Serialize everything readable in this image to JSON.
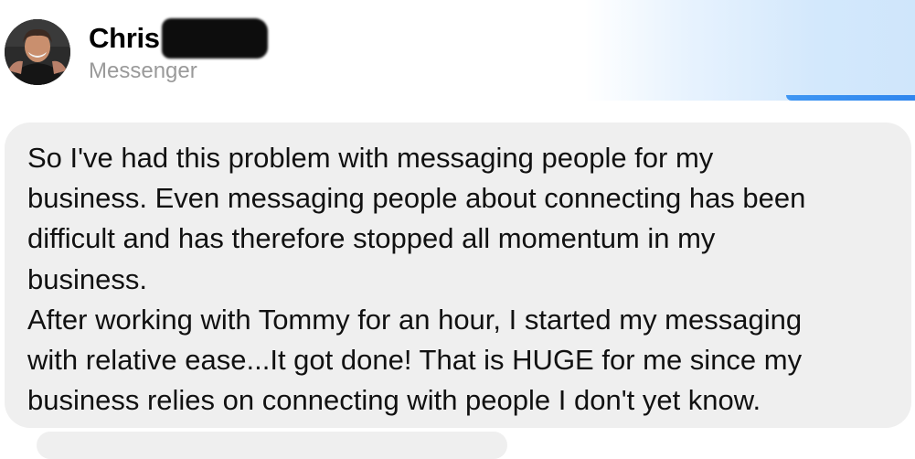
{
  "header": {
    "sender_name": "Chris",
    "source_label": "Messenger"
  },
  "message": {
    "lines": [
      "So I've had this problem with messaging people for my",
      "business. Even messaging people about connecting has been",
      "difficult and has therefore stopped all momentum in my",
      "business.",
      "After working with Tommy for an hour, I started my messaging",
      "with relative ease...It got done! That is HUGE for me since my",
      "business relies on connecting with people I don't yet know."
    ]
  },
  "colors": {
    "bubble_background": "#efefef",
    "text": "#111111",
    "secondary_text": "#9a9a9a",
    "outgoing_bubble": "#3f96f3",
    "redaction": "#0d0d0d"
  },
  "icons": {
    "avatar": "profile-photo"
  }
}
